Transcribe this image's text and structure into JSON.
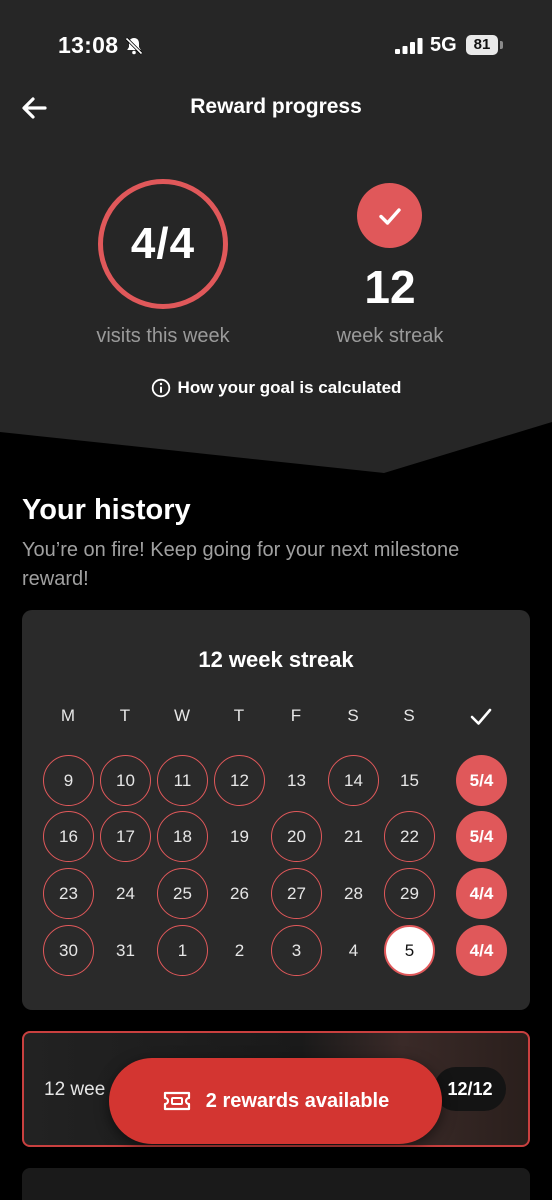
{
  "status_bar": {
    "time": "13:08",
    "network": "5G",
    "battery": "81"
  },
  "header": {
    "title": "Reward progress"
  },
  "summary": {
    "visits_value": "4/4",
    "visits_label": "visits this week",
    "streak_value": "12",
    "streak_label": "week streak",
    "goal_link": "How your goal is calculated"
  },
  "history": {
    "title": "Your history",
    "subtitle": "You’re on fire! Keep going for your next milestone reward!"
  },
  "calendar": {
    "title": "12 week streak",
    "day_headers": [
      "M",
      "T",
      "W",
      "T",
      "F",
      "S",
      "S"
    ],
    "weeks": [
      {
        "days": [
          {
            "d": "9",
            "v": true
          },
          {
            "d": "10",
            "v": true
          },
          {
            "d": "11",
            "v": true
          },
          {
            "d": "12",
            "v": true
          },
          {
            "d": "13",
            "v": false
          },
          {
            "d": "14",
            "v": true
          },
          {
            "d": "15",
            "v": false
          }
        ],
        "score": "5/4"
      },
      {
        "days": [
          {
            "d": "16",
            "v": true
          },
          {
            "d": "17",
            "v": true
          },
          {
            "d": "18",
            "v": true
          },
          {
            "d": "19",
            "v": false
          },
          {
            "d": "20",
            "v": true
          },
          {
            "d": "21",
            "v": false
          },
          {
            "d": "22",
            "v": true
          }
        ],
        "score": "5/4"
      },
      {
        "days": [
          {
            "d": "23",
            "v": true
          },
          {
            "d": "24",
            "v": false
          },
          {
            "d": "25",
            "v": true
          },
          {
            "d": "26",
            "v": false
          },
          {
            "d": "27",
            "v": true
          },
          {
            "d": "28",
            "v": false
          },
          {
            "d": "29",
            "v": true
          }
        ],
        "score": "4/4"
      },
      {
        "days": [
          {
            "d": "30",
            "v": true
          },
          {
            "d": "31",
            "v": false
          },
          {
            "d": "1",
            "v": true
          },
          {
            "d": "2",
            "v": false
          },
          {
            "d": "3",
            "v": true
          },
          {
            "d": "4",
            "v": false
          },
          {
            "d": "5",
            "v": false,
            "today": true
          }
        ],
        "score": "4/4"
      }
    ]
  },
  "reward_card": {
    "title": "12 wee",
    "progress": "12/12"
  },
  "rewards_button": {
    "label": "2 rewards available"
  },
  "colors": {
    "accent": "#e0585a",
    "button": "#d33531",
    "card": "#2a2a2a",
    "top_bg": "#262626"
  },
  "icons": {
    "back": "arrow-left-icon",
    "check": "checkmark-icon",
    "info": "info-icon",
    "ticket": "ticket-icon",
    "bell": "bell-slash-icon",
    "signal": "signal-icon"
  }
}
